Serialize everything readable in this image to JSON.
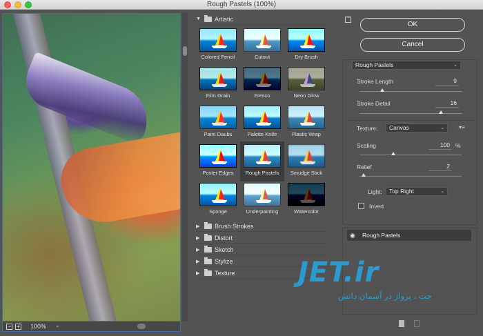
{
  "window": {
    "title": "Rough Pastels (100%)"
  },
  "preview": {
    "zoom": "100%",
    "zoom_out": "−",
    "zoom_in": "+"
  },
  "gallery": {
    "open_category": "Artistic",
    "filters": [
      "Colored Pencil",
      "Cutout",
      "Dry Brush",
      "Film Grain",
      "Fresco",
      "Neon Glow",
      "Paint Daubs",
      "Palette Knife",
      "Plastic Wrap",
      "Poster Edges",
      "Rough Pastels",
      "Smudge Stick",
      "Sponge",
      "Underpainting",
      "Watercolor"
    ],
    "selected": "Rough Pastels",
    "categories": [
      "Brush Strokes",
      "Distort",
      "Sketch",
      "Stylize",
      "Texture"
    ]
  },
  "buttons": {
    "ok": "OK",
    "cancel": "Cancel"
  },
  "settings": {
    "filter": "Rough Pastels",
    "stroke_length_label": "Stroke Length",
    "stroke_length": "9",
    "stroke_length_level": 0.225,
    "stroke_detail_label": "Stroke Detail",
    "stroke_detail": "16",
    "stroke_detail_level": 0.8,
    "texture_label": "Texture:",
    "texture": "Canvas",
    "scaling_label": "Scaling",
    "scaling": "100",
    "scaling_unit": "%",
    "scaling_level": 0.33,
    "relief_label": "Relief",
    "relief": "2",
    "relief_level": 0.04,
    "light_label": "Light:",
    "light": "Top Right",
    "invert_label": "Invert",
    "invert_checked": false
  },
  "layers": [
    {
      "name": "Rough Pastels",
      "visible": true
    }
  ],
  "watermark": {
    "logo": "JET.ir",
    "subtitle": "جت ، پرواز در آسمان دانش"
  },
  "colors": {
    "panel": "#535353",
    "accent": "#3e6fa6",
    "watermark": "#2a9bd0"
  }
}
